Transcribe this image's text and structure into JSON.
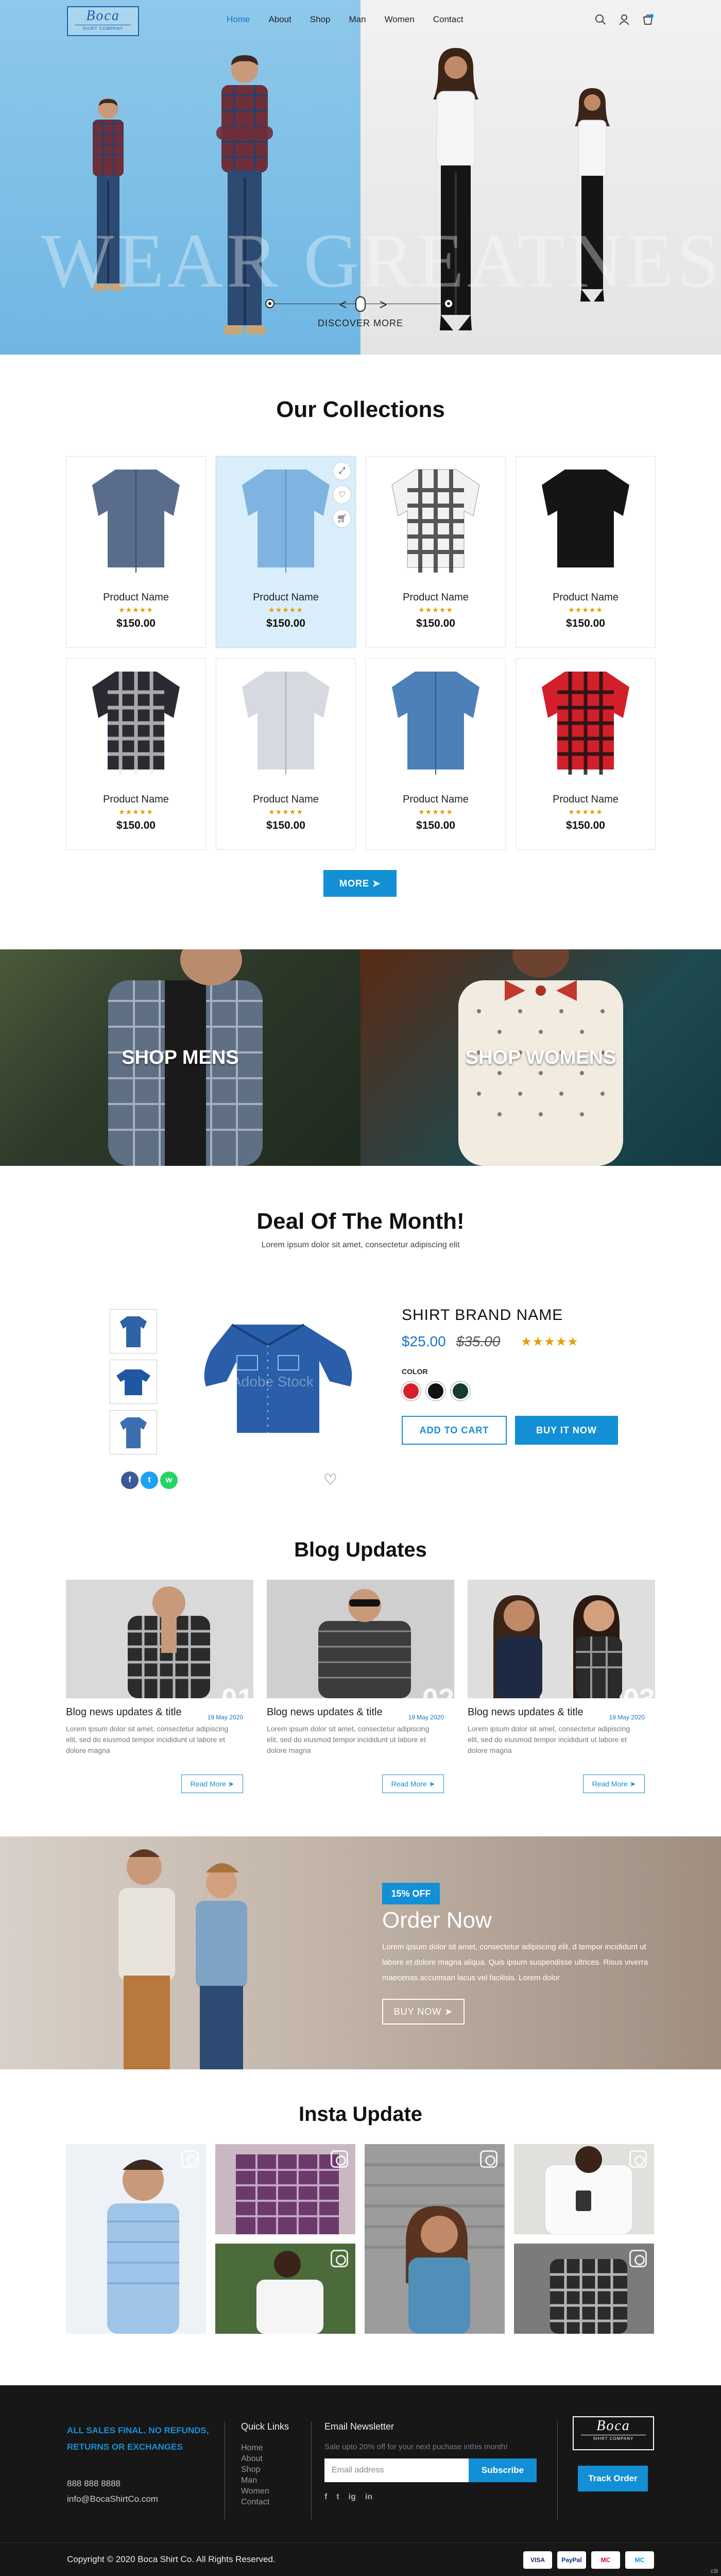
{
  "brand": {
    "logo_main": "Boca",
    "logo_sub": "SHIRT COMPANY"
  },
  "nav": {
    "items": [
      {
        "label": "Home",
        "active": true
      },
      {
        "label": "About"
      },
      {
        "label": "Shop"
      },
      {
        "label": "Man"
      },
      {
        "label": "Women"
      },
      {
        "label": "Contact"
      }
    ],
    "icons": [
      "search-icon",
      "user-icon",
      "cart-icon"
    ]
  },
  "hero": {
    "watermark": "WEAR GREATNESS",
    "discover_label": "DISCOVER MORE",
    "colors": {
      "left_bg": "#7dbfe7",
      "right_bg": "#ececec"
    }
  },
  "collections": {
    "title": "Our Collections",
    "products": [
      {
        "name": "Product Name",
        "price": "$150.00",
        "stars": "★★★★★",
        "shirt": "denim-gray"
      },
      {
        "name": "Product Name",
        "price": "$150.00",
        "stars": "★★★★★",
        "shirt": "light-blue",
        "highlight": true
      },
      {
        "name": "Product Name",
        "price": "$150.00",
        "stars": "★★★★★",
        "shirt": "check-bw"
      },
      {
        "name": "Product Name",
        "price": "$150.00",
        "stars": "★★★★★",
        "shirt": "black"
      },
      {
        "name": "Product Name",
        "price": "$150.00",
        "stars": "★★★★★",
        "shirt": "check-dark"
      },
      {
        "name": "Product Name",
        "price": "$150.00",
        "stars": "★★★★★",
        "shirt": "light-gray"
      },
      {
        "name": "Product Name",
        "price": "$150.00",
        "stars": "★★★★★",
        "shirt": "denim-blue"
      },
      {
        "name": "Product Name",
        "price": "$150.00",
        "stars": "★★★★★",
        "shirt": "check-red"
      }
    ],
    "more_label": "MORE ➤"
  },
  "shop_banners": {
    "mens_label": "SHOP MENS",
    "womens_label": "SHOP WOMENS"
  },
  "deal": {
    "title": "Deal Of The Month!",
    "subtitle": "Lorem ipsum dolor sit amet, consectetur adipiscing elit",
    "brand_name": "SHIRT BRAND NAME",
    "price": "$25.00",
    "old_price": "$35.00",
    "stars": "★★★★★",
    "color_label": "COLOR",
    "swatches": [
      "#d4202a",
      "#111111",
      "#173b2b"
    ],
    "add_to_cart": "ADD TO CART",
    "buy_now": "BUY IT NOW",
    "watermark": "Adobe Stock"
  },
  "blog": {
    "title": "Blog Updates",
    "posts": [
      {
        "num": "01",
        "title": "Blog news updates & title",
        "date": "19 May 2020",
        "text": "Lorem ipsum dolor sit amet, consectetur adipiscing elit, sed do eiusmod tempor incididunt ut labore et dolore magna",
        "read_more": "Read More ➤"
      },
      {
        "num": "02",
        "title": "Blog news updates & title",
        "date": "19 May 2020",
        "text": "Lorem ipsum dolor sit amet, consectetur adipiscing elit, sed do eiusmod tempor incididunt ut labore et dolore magna",
        "read_more": "Read More ➤"
      },
      {
        "num": "03",
        "title": "Blog news updates & title",
        "date": "19 May 2020",
        "text": "Lorem ipsum dolor sit amet, consectetur adipiscing elit, sed do eiusmod tempor incididunt ut labore et dolore magna",
        "read_more": "Read More ➤"
      }
    ]
  },
  "order": {
    "badge": "15% OFF",
    "title": "Order Now",
    "text": "Lorem ipsum dolor sit amet, consectetur adipiscing elit, d tempor incididunt ut labore et dolore magna aliqua. Quis ipsum suspendisse ultrices. Risus viverra maecenas accumsan lacus vel facilisis. Lorem dolor",
    "button": "BUY NOW ➤"
  },
  "insta": {
    "title": "Insta Update"
  },
  "footer": {
    "policy": "ALL SALES FINAL. NO REFUNDS, RETURNS OR EXCHANGES",
    "phone": "888 888 8888",
    "email": "info@BocaShirtCo.com",
    "quick_links_title": "Quick Links",
    "quick_links": [
      "Home",
      "About",
      "Shop",
      "Man",
      "Women",
      "Contact"
    ],
    "newsletter_title": "Email Newsletter",
    "newsletter_text": "Sale upto 20% off for your next puchase inthis month!",
    "email_placeholder": "Email address",
    "subscribe": "Subscribe",
    "social": [
      "f",
      "t",
      "ig",
      "in"
    ],
    "track_order": "Track Order",
    "copyright": "Copyright © 2020 Boca Shirt Co. All Rights Reserved.",
    "payments": [
      "VISA",
      "PayPal",
      "MC",
      "MC"
    ],
    "tiny": "c3i"
  }
}
